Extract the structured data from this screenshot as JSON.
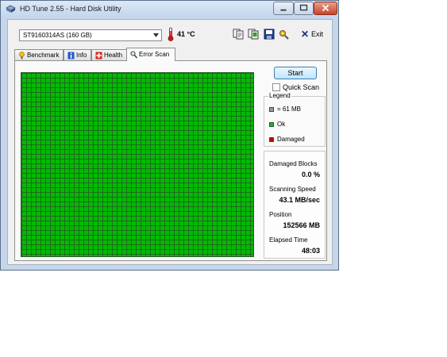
{
  "window": {
    "title": "HD Tune 2.55 - Hard Disk Utility"
  },
  "toolbar": {
    "drive": "ST9160314AS (160 GB)",
    "temperature": "41 °C",
    "exit_label": "Exit",
    "icons": [
      "copy-text-icon",
      "copy-screenshot-icon",
      "save-icon",
      "options-icon"
    ]
  },
  "tabs": [
    {
      "label": "Benchmark",
      "icon": "benchmark-icon",
      "active": false
    },
    {
      "label": "Info",
      "icon": "info-icon",
      "active": false
    },
    {
      "label": "Health",
      "icon": "health-icon",
      "active": false
    },
    {
      "label": "Error Scan",
      "icon": "magnifier-icon",
      "active": true
    }
  ],
  "scan": {
    "start_label": "Start",
    "quick_scan_label": "Quick Scan",
    "quick_scan_checked": false,
    "legend": {
      "title": "Legend",
      "block_size": "= 61 MB",
      "ok_label": "Ok",
      "damaged_label": "Damaged",
      "colors": {
        "block": "#9a9a9a",
        "ok": "#00c800",
        "damaged": "#c80000"
      }
    },
    "stats": {
      "damaged_blocks_label": "Damaged Blocks",
      "damaged_blocks_value": "0.0 %",
      "scanning_speed_label": "Scanning Speed",
      "scanning_speed_value": "43.1 MB/sec",
      "position_label": "Position",
      "position_value": "152566 MB",
      "elapsed_label": "Elapsed Time",
      "elapsed_value": "48:03"
    },
    "grid_color": "#00bb00"
  }
}
